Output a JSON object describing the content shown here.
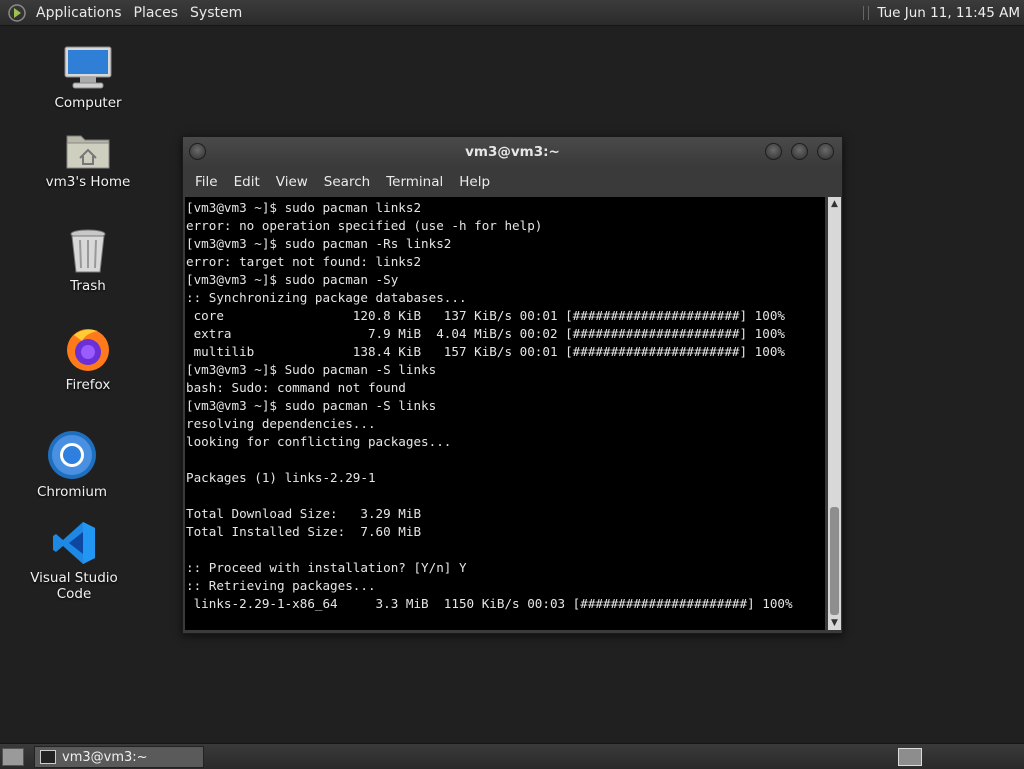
{
  "top_panel": {
    "menus": [
      "Applications",
      "Places",
      "System"
    ],
    "clock": "Tue Jun 11, 11:45 AM"
  },
  "desktop_icons": [
    {
      "label": "Computer",
      "icon": "computer-icon"
    },
    {
      "label": "vm3's Home",
      "icon": "home-folder-icon"
    },
    {
      "label": "Trash",
      "icon": "trash-icon"
    },
    {
      "label": "Firefox",
      "icon": "firefox-icon"
    },
    {
      "label": "Chromium",
      "icon": "chromium-icon"
    },
    {
      "label": "Visual Studio Code",
      "icon": "vscode-icon"
    }
  ],
  "terminal": {
    "title": "vm3@vm3:~",
    "menu": [
      "File",
      "Edit",
      "View",
      "Search",
      "Terminal",
      "Help"
    ],
    "output": "[vm3@vm3 ~]$ sudo pacman links2\nerror: no operation specified (use -h for help)\n[vm3@vm3 ~]$ sudo pacman -Rs links2\nerror: target not found: links2\n[vm3@vm3 ~]$ sudo pacman -Sy\n:: Synchronizing package databases...\n core                 120.8 KiB   137 KiB/s 00:01 [######################] 100%\n extra                  7.9 MiB  4.04 MiB/s 00:02 [######################] 100%\n multilib             138.4 KiB   157 KiB/s 00:01 [######################] 100%\n[vm3@vm3 ~]$ Sudo pacman -S links\nbash: Sudo: command not found\n[vm3@vm3 ~]$ sudo pacman -S links\nresolving dependencies...\nlooking for conflicting packages...\n\nPackages (1) links-2.29-1\n\nTotal Download Size:   3.29 MiB\nTotal Installed Size:  7.60 MiB\n\n:: Proceed with installation? [Y/n] Y\n:: Retrieving packages...\n links-2.29-1-x86_64     3.3 MiB  1150 KiB/s 00:03 [######################] 100%"
  },
  "taskbar": {
    "window_button": "vm3@vm3:~"
  },
  "colors": {
    "desktop": "#202020",
    "terminal_bg": "#000000",
    "terminal_fg": "#e6e6e6"
  }
}
